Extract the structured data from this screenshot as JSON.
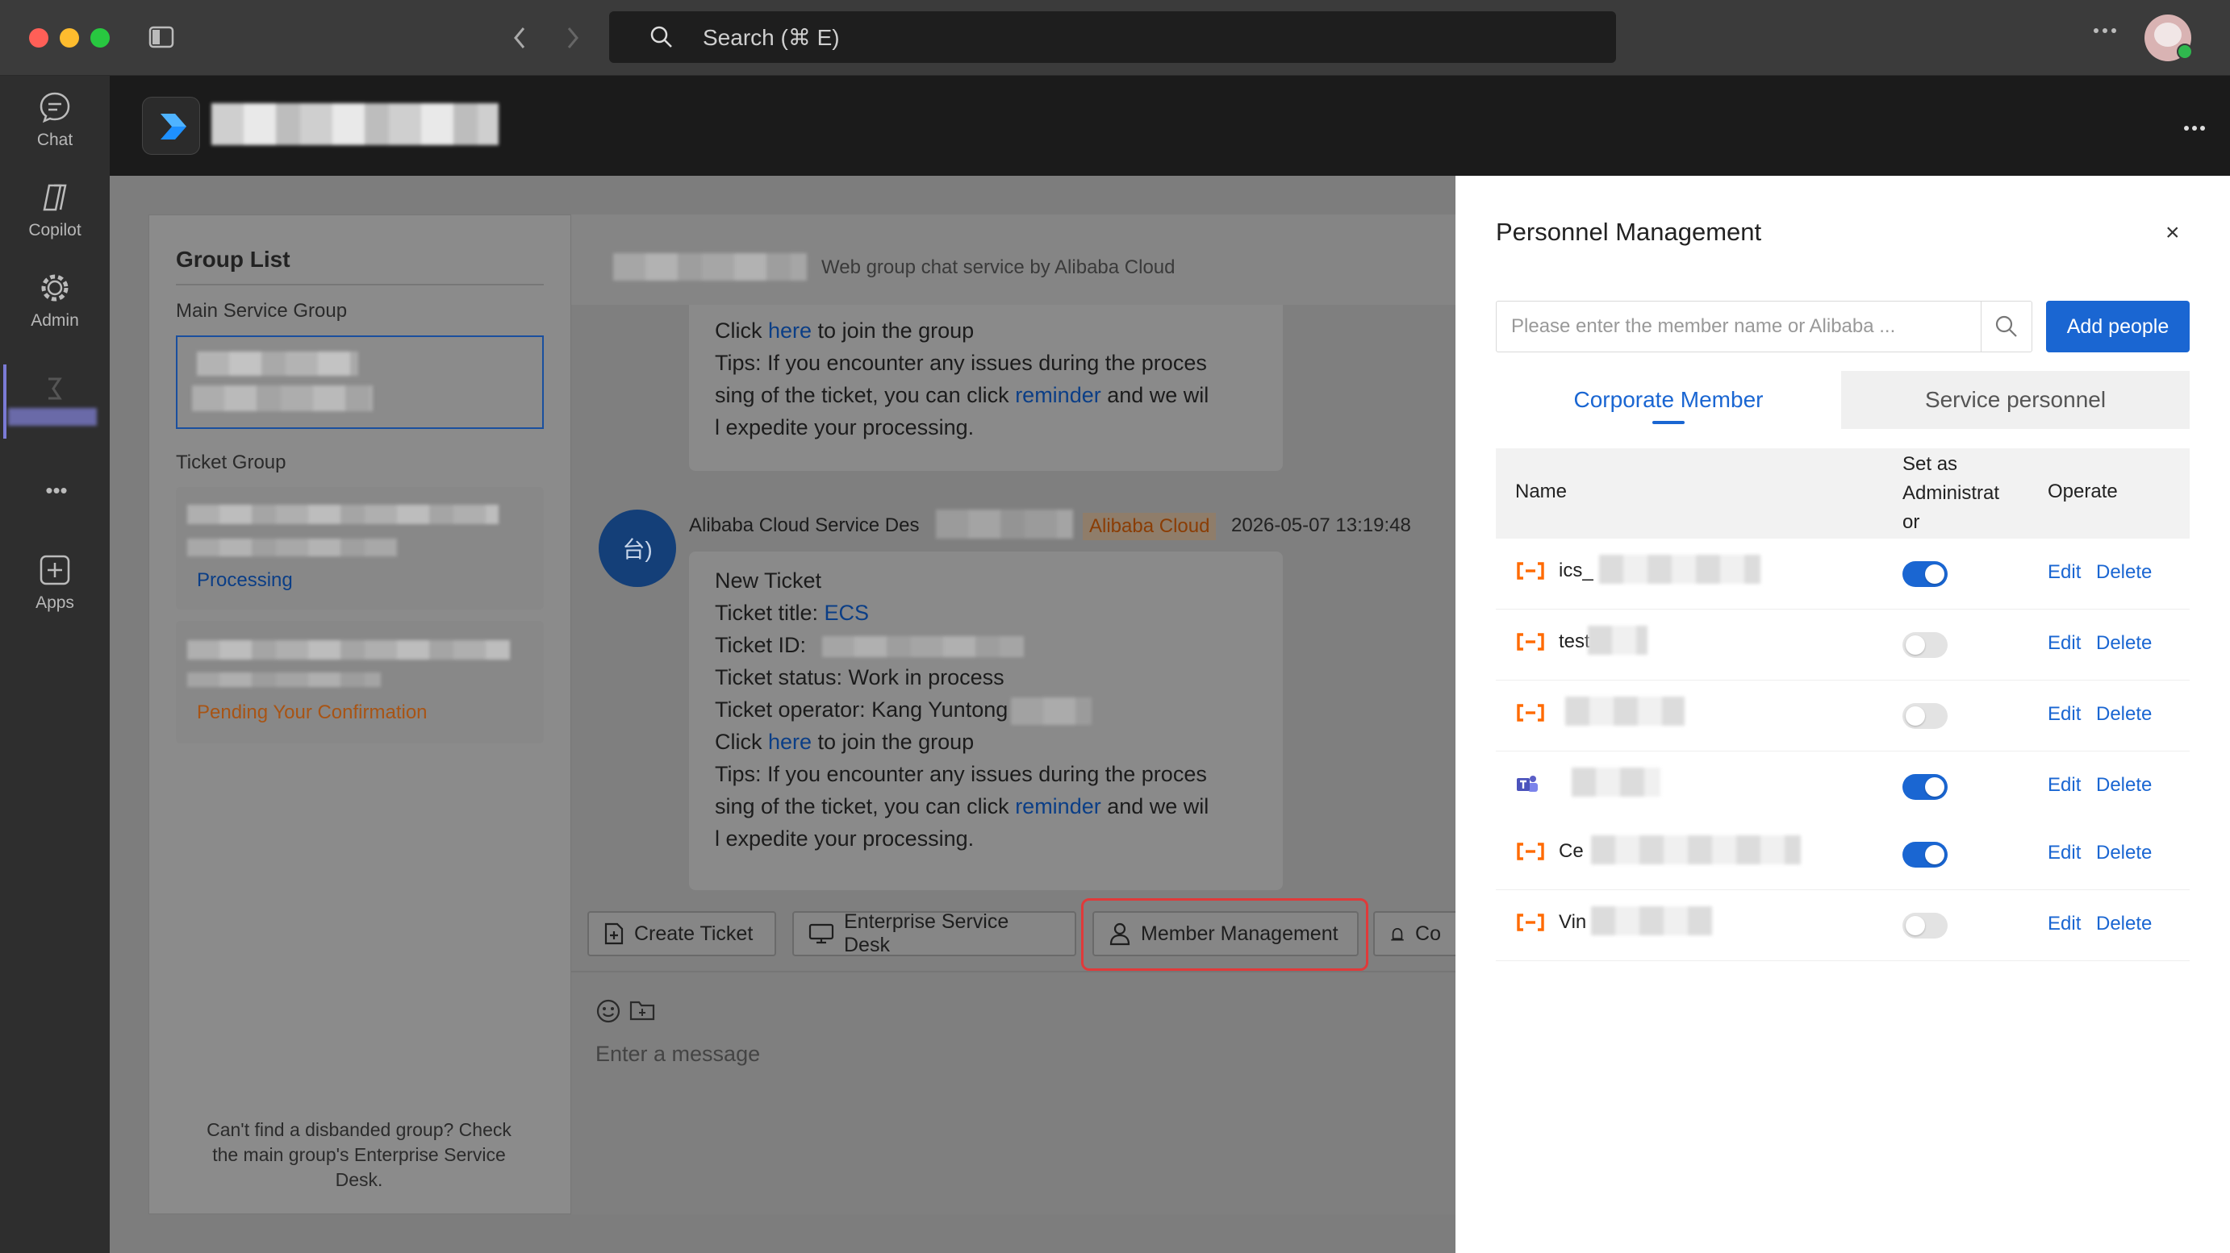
{
  "titlebar": {
    "search_placeholder": "Search (⌘ E)"
  },
  "rail": {
    "items": [
      {
        "label": "Chat"
      },
      {
        "label": "Copilot"
      },
      {
        "label": "Admin"
      },
      {
        "label": "Apps"
      }
    ],
    "more": "•••"
  },
  "group_list": {
    "title": "Group List",
    "main_service_group_label": "Main Service Group",
    "ticket_group_label": "Ticket Group",
    "tickets": [
      {
        "status": "Processing",
        "status_color": "#0b3e86"
      },
      {
        "status": "Pending Your Confirmation",
        "status_color": "#b5561a"
      }
    ],
    "footer": "Can't find a disbanded group? Check the main group's Enterprise Service Desk."
  },
  "chat": {
    "header_subtitle": "Web group chat service by Alibaba Cloud",
    "message1": {
      "line_click_prefix": "Click ",
      "here": "here",
      "line_click_suffix": " to join the group",
      "tips_a": "Tips: If you encounter any issues during the proces",
      "tips_b_prefix": "sing of the ticket, you can click ",
      "reminder": "reminder",
      "tips_b_suffix": " and we wil",
      "tips_c": "l expedite your processing."
    },
    "message2": {
      "avatar_text": "台)",
      "sender": "Alibaba Cloud Service Des",
      "org_tag": "Alibaba Cloud",
      "timestamp": "2026-05-07 13:19:48",
      "title": "New Ticket",
      "ticket_title_label": "Ticket title: ",
      "ticket_title_value": "ECS",
      "ticket_id_label": "Ticket ID:",
      "ticket_status": "Ticket status: Work in process",
      "ticket_operator": "Ticket operator: Kang Yuntong",
      "line_click_prefix": "Click ",
      "here": "here",
      "line_click_suffix": " to join the group",
      "tips_a": "Tips: If you encounter any issues during the proces",
      "tips_b_prefix": "sing of the ticket, you can click ",
      "reminder": "reminder",
      "tips_b_suffix": " and we wil",
      "tips_c": "l expedite your processing."
    },
    "quick_actions": {
      "create_ticket": "Create Ticket",
      "enterprise_service_desk": "Enterprise Service Desk",
      "member_management": "Member Management",
      "cut_off": "Co"
    },
    "input_placeholder": "Enter a message"
  },
  "drawer": {
    "title": "Personnel Management",
    "close": "×",
    "search_placeholder": "Please enter the member name or Alibaba ...",
    "add_people": "Add people",
    "tabs": [
      {
        "label": "Corporate Member",
        "active": true
      },
      {
        "label": "Service personnel",
        "active": false
      }
    ],
    "table": {
      "headers": {
        "name": "Name",
        "admin_line1": "Set as",
        "admin_line2": "Administrat",
        "admin_line3": "or",
        "operate": "Operate"
      },
      "rows": [
        {
          "name": "ics_",
          "icon": "alibaba-cloud-icon",
          "admin": true
        },
        {
          "name": "test",
          "icon": "alibaba-cloud-icon",
          "admin": false
        },
        {
          "name": "",
          "icon": "alibaba-cloud-icon",
          "admin": false
        },
        {
          "name": "",
          "icon": "teams-icon",
          "admin": true
        },
        {
          "name": "Ce",
          "icon": "alibaba-cloud-icon",
          "admin": true
        },
        {
          "name": "Vin",
          "icon": "alibaba-cloud-icon",
          "admin": false
        }
      ],
      "edit_label": "Edit",
      "delete_label": "Delete"
    }
  },
  "colors": {
    "accent": "#1a66d2",
    "alibaba_orange": "#ff6a00",
    "highlight_red": "#e03a3a"
  }
}
